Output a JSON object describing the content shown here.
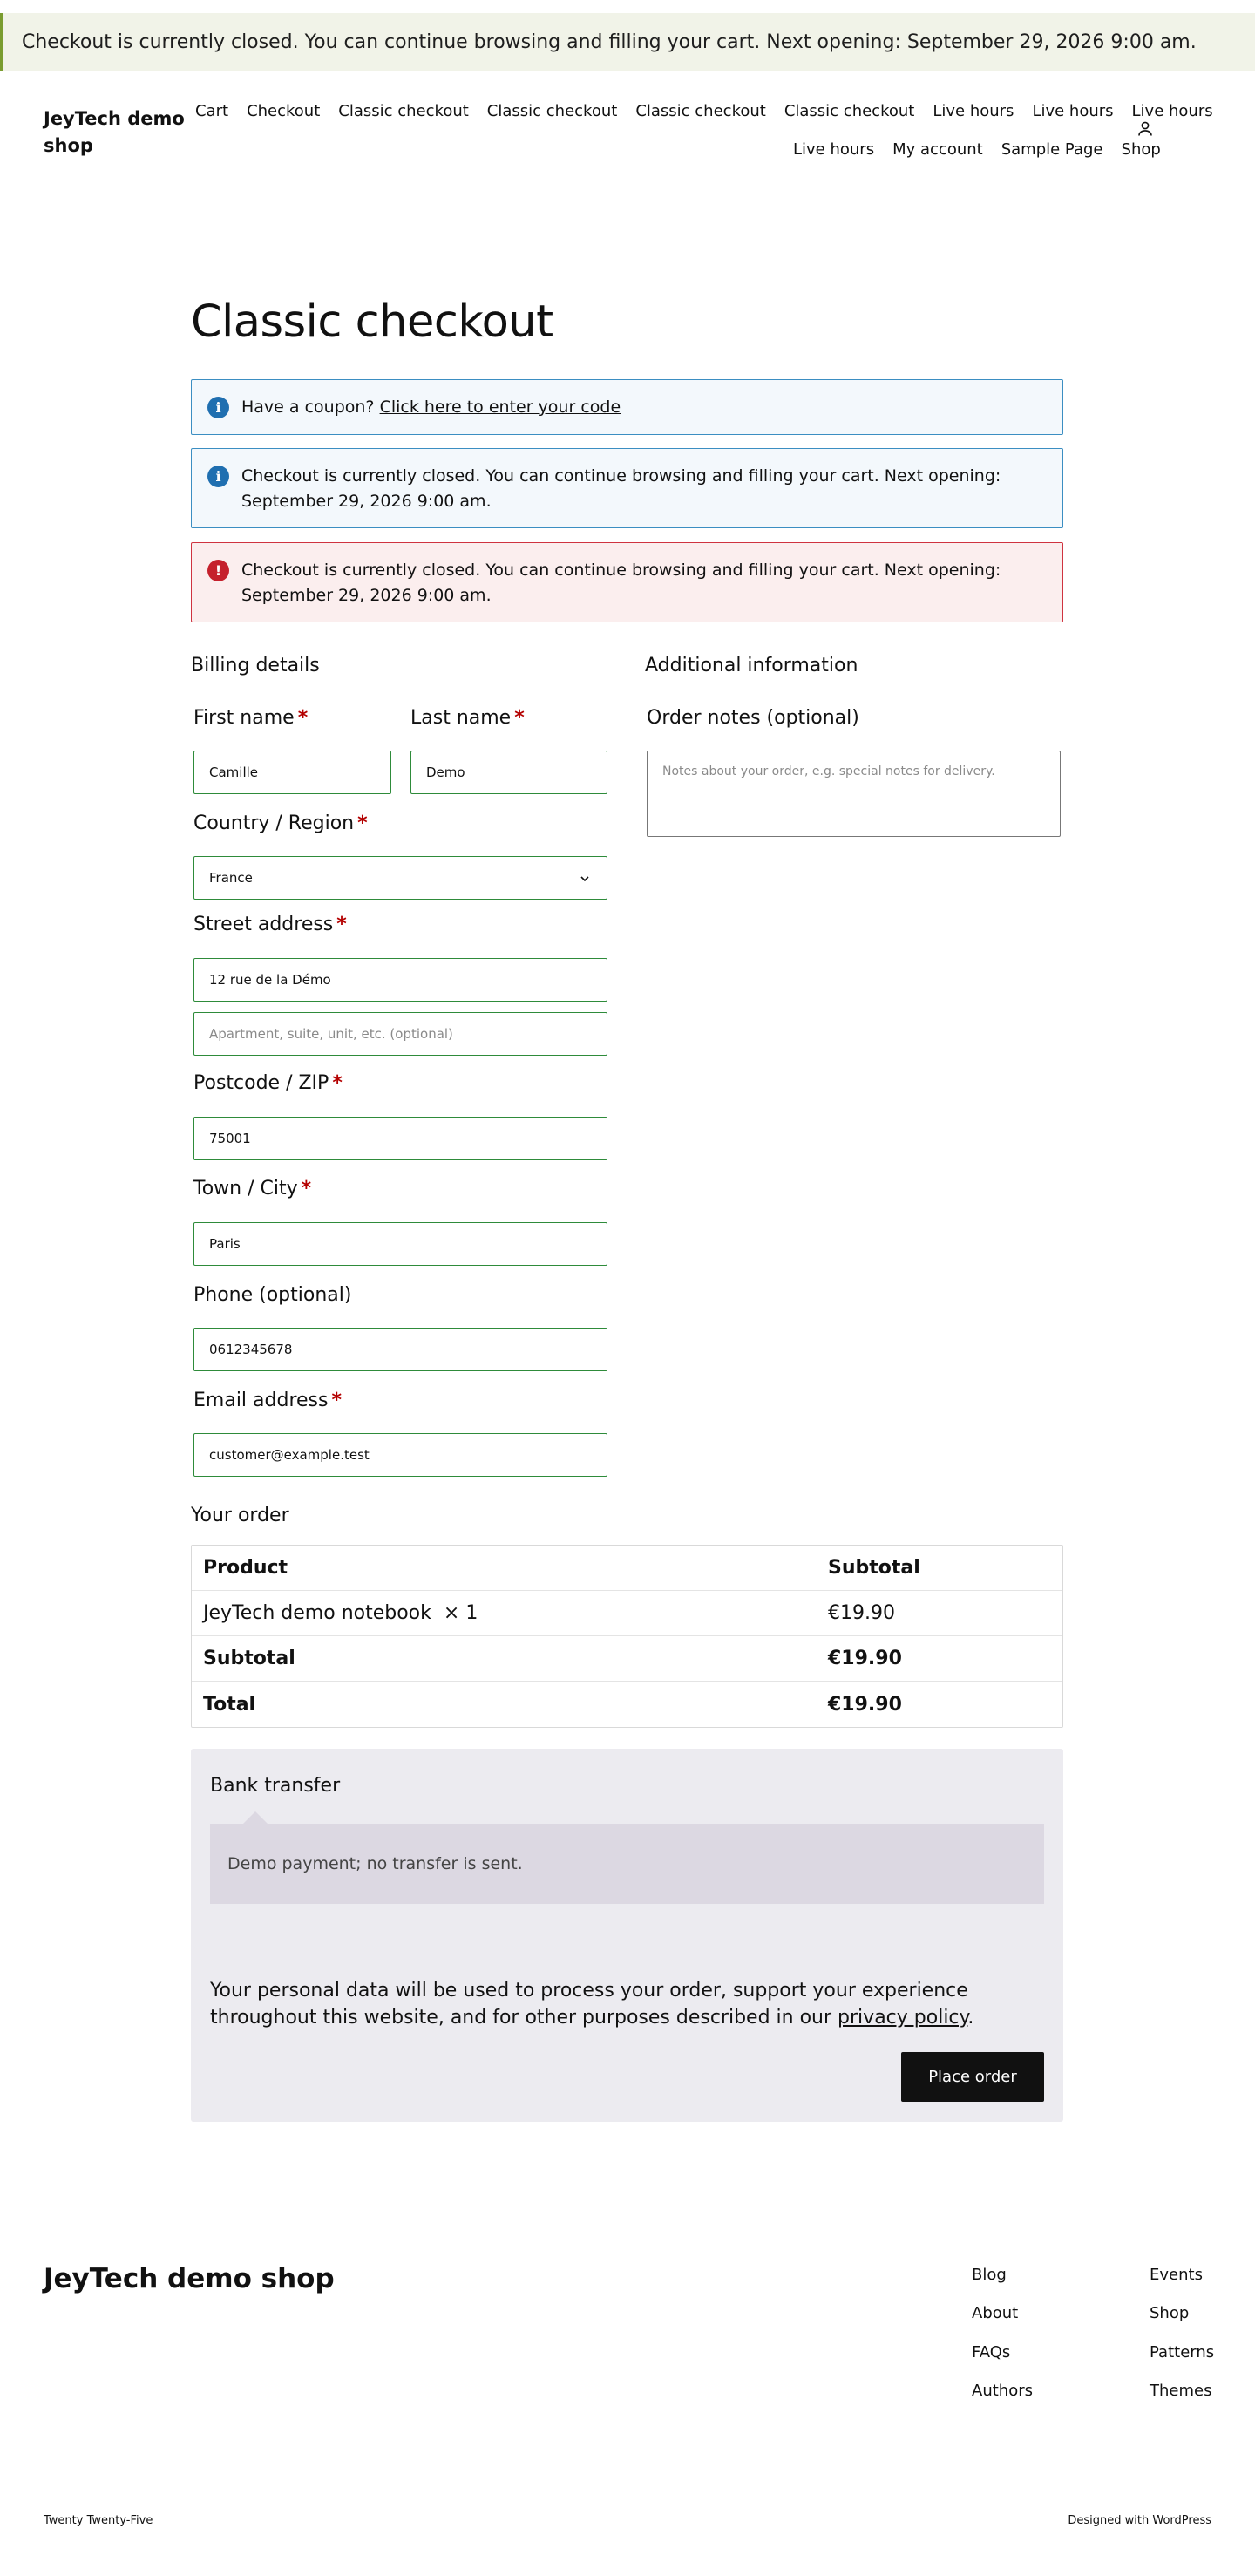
{
  "store_notice": "Checkout is currently closed. You can continue browsing and filling your cart. Next opening: September 29, 2026 9:00 am.",
  "site_title": "JeyTech demo shop",
  "nav": {
    "row1": [
      "Cart",
      "Checkout",
      "Classic checkout",
      "Classic checkout",
      "Classic checkout",
      "Classic checkout",
      "Live hours",
      "Live hours",
      "Live hours"
    ],
    "row2": [
      "Live hours",
      "My account",
      "Sample Page",
      "Shop"
    ],
    "account_icon": "user-icon"
  },
  "page_title": "Classic checkout",
  "notices": {
    "coupon_text": "Have a coupon?",
    "coupon_link": "Click here to enter your code",
    "closed_info": "Checkout is currently closed. You can continue browsing and filling your cart. Next opening: September 29, 2026 9:00 am.",
    "closed_error": "Checkout is currently closed. You can continue browsing and filling your cart. Next opening: September 29, 2026 9:00 am."
  },
  "billing": {
    "heading": "Billing details",
    "first_name_label": "First name",
    "first_name_value": "Camille",
    "last_name_label": "Last name",
    "last_name_value": "Demo",
    "country_label": "Country / Region",
    "country_value": "France",
    "street_label": "Street address",
    "street_value": "12 rue de la Démo",
    "street2_placeholder": "Apartment, suite, unit, etc. (optional)",
    "postcode_label": "Postcode / ZIP",
    "postcode_value": "75001",
    "city_label": "Town / City",
    "city_value": "Paris",
    "phone_label": "Phone (optional)",
    "phone_value": "0612345678",
    "email_label": "Email address",
    "email_value": "customer@example.test",
    "required_mark": "*"
  },
  "additional": {
    "heading": "Additional information",
    "notes_label": "Order notes (optional)",
    "notes_placeholder": "Notes about your order, e.g. special notes for delivery."
  },
  "order": {
    "heading": "Your order",
    "col_product": "Product",
    "col_subtotal": "Subtotal",
    "item_name": "JeyTech demo notebook",
    "item_qty": "× 1",
    "item_price": "€19.90",
    "subtotal_label": "Subtotal",
    "subtotal_value": "€19.90",
    "total_label": "Total",
    "total_value": "€19.90"
  },
  "payment": {
    "method": "Bank transfer",
    "description": "Demo payment; no transfer is sent.",
    "privacy_text": "Your personal data will be used to process your order, support your experience throughout this website, and for other purposes described in our",
    "privacy_link": "privacy policy",
    "privacy_end": ".",
    "place_order": "Place order"
  },
  "footer": {
    "title": "JeyTech demo shop",
    "col1": [
      "Blog",
      "About",
      "FAQs",
      "Authors"
    ],
    "col2": [
      "Events",
      "Shop",
      "Patterns",
      "Themes"
    ],
    "theme": "Twenty Twenty-Five",
    "designed_with": "Designed with",
    "wordpress": "WordPress"
  }
}
